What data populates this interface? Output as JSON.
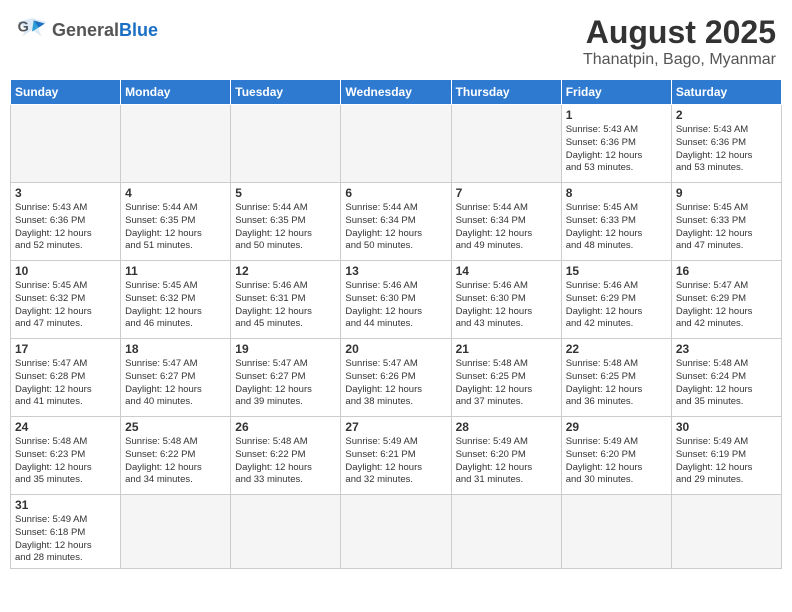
{
  "header": {
    "logo_general": "General",
    "logo_blue": "Blue",
    "month_year": "August 2025",
    "location": "Thanatpin, Bago, Myanmar"
  },
  "weekdays": [
    "Sunday",
    "Monday",
    "Tuesday",
    "Wednesday",
    "Thursday",
    "Friday",
    "Saturday"
  ],
  "weeks": [
    [
      {
        "day": "",
        "info": ""
      },
      {
        "day": "",
        "info": ""
      },
      {
        "day": "",
        "info": ""
      },
      {
        "day": "",
        "info": ""
      },
      {
        "day": "",
        "info": ""
      },
      {
        "day": "1",
        "info": "Sunrise: 5:43 AM\nSunset: 6:36 PM\nDaylight: 12 hours\nand 53 minutes."
      },
      {
        "day": "2",
        "info": "Sunrise: 5:43 AM\nSunset: 6:36 PM\nDaylight: 12 hours\nand 53 minutes."
      }
    ],
    [
      {
        "day": "3",
        "info": "Sunrise: 5:43 AM\nSunset: 6:36 PM\nDaylight: 12 hours\nand 52 minutes."
      },
      {
        "day": "4",
        "info": "Sunrise: 5:44 AM\nSunset: 6:35 PM\nDaylight: 12 hours\nand 51 minutes."
      },
      {
        "day": "5",
        "info": "Sunrise: 5:44 AM\nSunset: 6:35 PM\nDaylight: 12 hours\nand 50 minutes."
      },
      {
        "day": "6",
        "info": "Sunrise: 5:44 AM\nSunset: 6:34 PM\nDaylight: 12 hours\nand 50 minutes."
      },
      {
        "day": "7",
        "info": "Sunrise: 5:44 AM\nSunset: 6:34 PM\nDaylight: 12 hours\nand 49 minutes."
      },
      {
        "day": "8",
        "info": "Sunrise: 5:45 AM\nSunset: 6:33 PM\nDaylight: 12 hours\nand 48 minutes."
      },
      {
        "day": "9",
        "info": "Sunrise: 5:45 AM\nSunset: 6:33 PM\nDaylight: 12 hours\nand 47 minutes."
      }
    ],
    [
      {
        "day": "10",
        "info": "Sunrise: 5:45 AM\nSunset: 6:32 PM\nDaylight: 12 hours\nand 47 minutes."
      },
      {
        "day": "11",
        "info": "Sunrise: 5:45 AM\nSunset: 6:32 PM\nDaylight: 12 hours\nand 46 minutes."
      },
      {
        "day": "12",
        "info": "Sunrise: 5:46 AM\nSunset: 6:31 PM\nDaylight: 12 hours\nand 45 minutes."
      },
      {
        "day": "13",
        "info": "Sunrise: 5:46 AM\nSunset: 6:30 PM\nDaylight: 12 hours\nand 44 minutes."
      },
      {
        "day": "14",
        "info": "Sunrise: 5:46 AM\nSunset: 6:30 PM\nDaylight: 12 hours\nand 43 minutes."
      },
      {
        "day": "15",
        "info": "Sunrise: 5:46 AM\nSunset: 6:29 PM\nDaylight: 12 hours\nand 42 minutes."
      },
      {
        "day": "16",
        "info": "Sunrise: 5:47 AM\nSunset: 6:29 PM\nDaylight: 12 hours\nand 42 minutes."
      }
    ],
    [
      {
        "day": "17",
        "info": "Sunrise: 5:47 AM\nSunset: 6:28 PM\nDaylight: 12 hours\nand 41 minutes."
      },
      {
        "day": "18",
        "info": "Sunrise: 5:47 AM\nSunset: 6:27 PM\nDaylight: 12 hours\nand 40 minutes."
      },
      {
        "day": "19",
        "info": "Sunrise: 5:47 AM\nSunset: 6:27 PM\nDaylight: 12 hours\nand 39 minutes."
      },
      {
        "day": "20",
        "info": "Sunrise: 5:47 AM\nSunset: 6:26 PM\nDaylight: 12 hours\nand 38 minutes."
      },
      {
        "day": "21",
        "info": "Sunrise: 5:48 AM\nSunset: 6:25 PM\nDaylight: 12 hours\nand 37 minutes."
      },
      {
        "day": "22",
        "info": "Sunrise: 5:48 AM\nSunset: 6:25 PM\nDaylight: 12 hours\nand 36 minutes."
      },
      {
        "day": "23",
        "info": "Sunrise: 5:48 AM\nSunset: 6:24 PM\nDaylight: 12 hours\nand 35 minutes."
      }
    ],
    [
      {
        "day": "24",
        "info": "Sunrise: 5:48 AM\nSunset: 6:23 PM\nDaylight: 12 hours\nand 35 minutes."
      },
      {
        "day": "25",
        "info": "Sunrise: 5:48 AM\nSunset: 6:22 PM\nDaylight: 12 hours\nand 34 minutes."
      },
      {
        "day": "26",
        "info": "Sunrise: 5:48 AM\nSunset: 6:22 PM\nDaylight: 12 hours\nand 33 minutes."
      },
      {
        "day": "27",
        "info": "Sunrise: 5:49 AM\nSunset: 6:21 PM\nDaylight: 12 hours\nand 32 minutes."
      },
      {
        "day": "28",
        "info": "Sunrise: 5:49 AM\nSunset: 6:20 PM\nDaylight: 12 hours\nand 31 minutes."
      },
      {
        "day": "29",
        "info": "Sunrise: 5:49 AM\nSunset: 6:20 PM\nDaylight: 12 hours\nand 30 minutes."
      },
      {
        "day": "30",
        "info": "Sunrise: 5:49 AM\nSunset: 6:19 PM\nDaylight: 12 hours\nand 29 minutes."
      }
    ],
    [
      {
        "day": "31",
        "info": "Sunrise: 5:49 AM\nSunset: 6:18 PM\nDaylight: 12 hours\nand 28 minutes."
      },
      {
        "day": "",
        "info": ""
      },
      {
        "day": "",
        "info": ""
      },
      {
        "day": "",
        "info": ""
      },
      {
        "day": "",
        "info": ""
      },
      {
        "day": "",
        "info": ""
      },
      {
        "day": "",
        "info": ""
      }
    ]
  ]
}
